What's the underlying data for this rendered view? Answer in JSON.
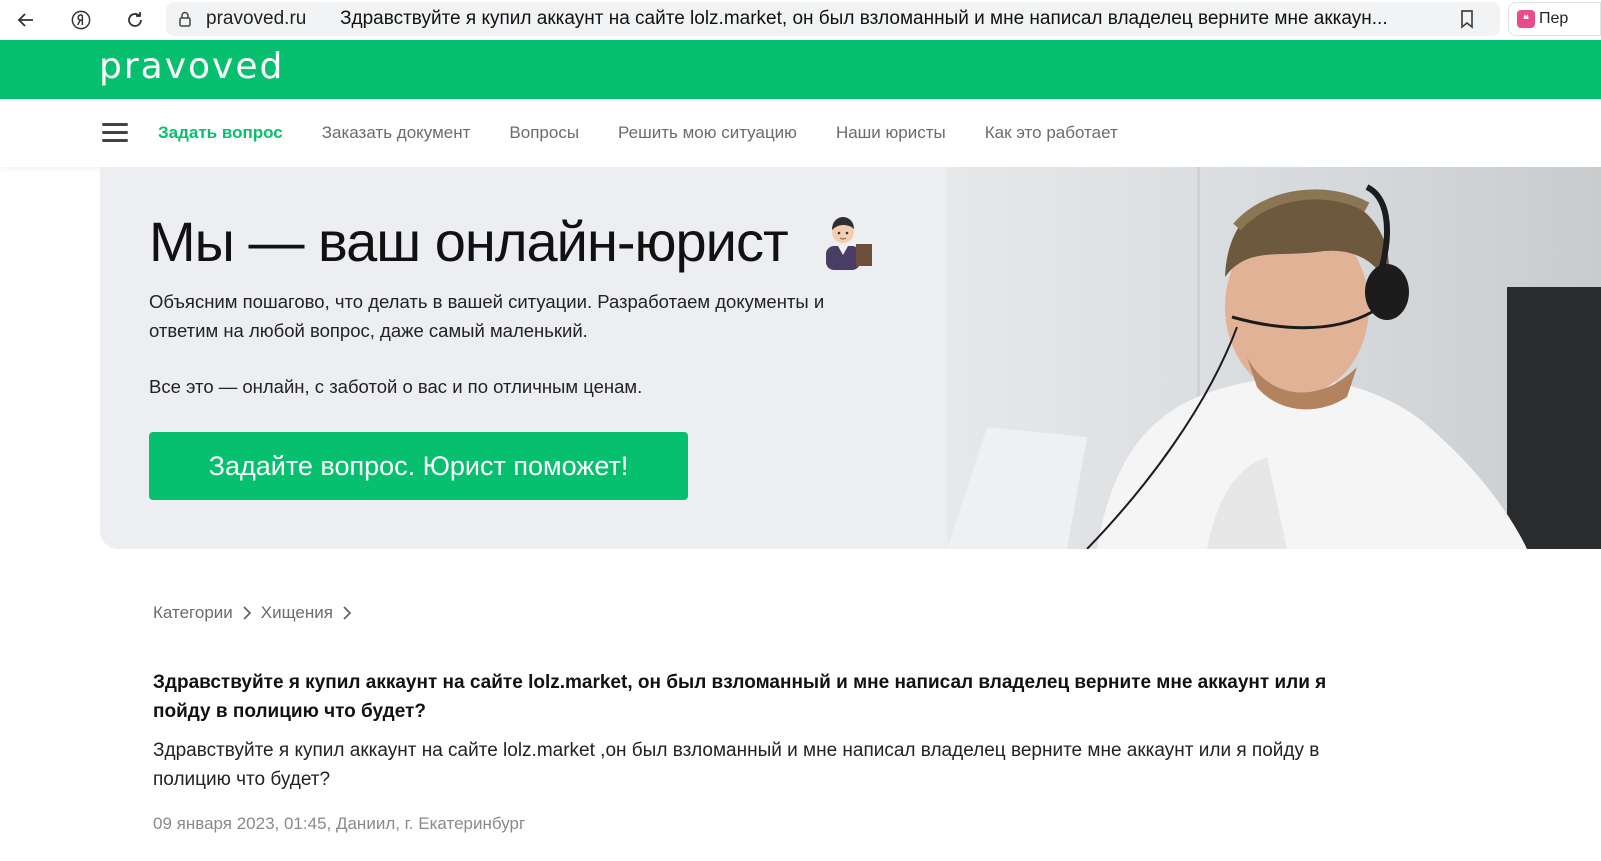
{
  "browser": {
    "domain": "pravoved.ru",
    "page_title": "Здравствуйте я купил аккаунт на сайте lolz.market, он был взломанный и мне написал владелец верните мне аккаун...",
    "extension_label": "Пер",
    "extension_icon_text": "❝"
  },
  "site": {
    "logo": "pravoved",
    "brand_color": "#06bf6f",
    "nav": [
      "Задать вопрос",
      "Заказать документ",
      "Вопросы",
      "Решить мою ситуацию",
      "Наши юристы",
      "Как это работает"
    ]
  },
  "hero": {
    "title": "Мы — ваш онлайн-юрист",
    "text1": "Объясним пошагово, что делать в вашей ситуации. Разработаем документы и ответим на любой вопрос, даже самый маленький.",
    "text2": "Все это — онлайн, с заботой о вас и по отличным ценам.",
    "cta": "Задайте вопрос. Юрист поможет!"
  },
  "breadcrumb": [
    "Категории",
    "Хищения"
  ],
  "question": {
    "title": "Здравствуйте я купил аккаунт на сайте lolz.market, он был взломанный и мне написал владелец верните мне аккаунт или я пойду в полицию что будет?",
    "body": "Здравствуйте я купил аккаунт на сайте lolz.market ,он был взломанный и мне написал владелец верните мне аккаунт или я пойду в полицию что будет?",
    "meta": "09 января 2023, 01:45, Даниил, г. Екатеринбург"
  }
}
